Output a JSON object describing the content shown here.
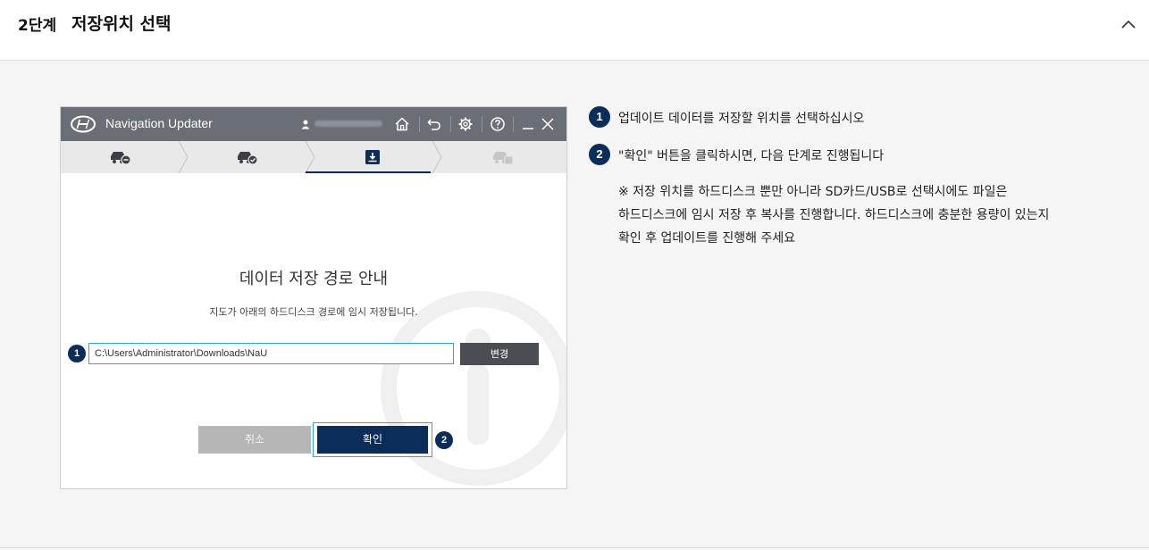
{
  "section": {
    "step_number": "2단계",
    "title": "저장위치 선택"
  },
  "app": {
    "title": "Navigation Updater",
    "dialog": {
      "title": "데이터 저장 경로 안내",
      "subtitle": "지도가 아래의 하드디스크 경로에 임시 저장됩니다.",
      "path_value": "C:\\Users\\Administrator\\Downloads\\NaU",
      "change_label": "변경",
      "cancel_label": "취소",
      "confirm_label": "확인",
      "badge_1": "1",
      "badge_2": "2"
    },
    "steps": [
      {
        "icon": "car-minus-icon",
        "state": "done"
      },
      {
        "icon": "car-check-icon",
        "state": "done"
      },
      {
        "icon": "download-box-icon",
        "state": "active"
      },
      {
        "icon": "car-disabled-icon",
        "state": "inactive"
      }
    ],
    "colors": {
      "titlebar": "#6a6f75",
      "accent": "#0a2d5a",
      "focus": "#27a8e0"
    }
  },
  "instructions": [
    {
      "num": "1",
      "text": "업데이트 데이터를 저장할 위치를 선택하십시오"
    },
    {
      "num": "2",
      "text": "\"확인\" 버튼을 클릭하시면, 다음 단계로 진행됩니다"
    }
  ],
  "note": {
    "line1": "※ 저장 위치를 하드디스크 뿐만 아니라 SD카드/USB로 선택시에도 파일은",
    "line2": "하드디스크에 임시 저장 후 복사를 진행합니다. 하드디스크에 충분한 용량이 있는지",
    "line3": "확인 후 업데이트를 진행해 주세요"
  }
}
